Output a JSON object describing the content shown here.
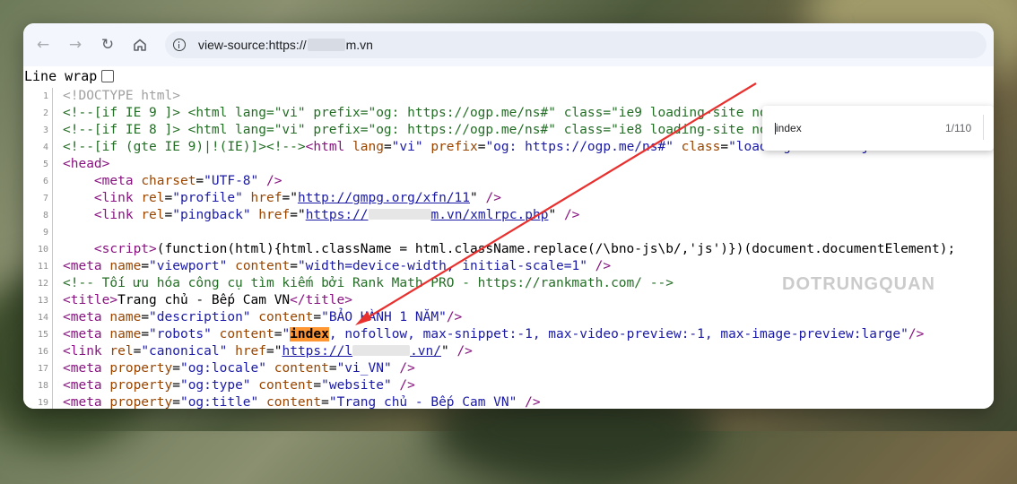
{
  "browser": {
    "url_prefix": "view-source:https://",
    "url_suffix": "m.vn"
  },
  "line_wrap_label": "Line wrap",
  "find": {
    "query": "index",
    "count": "1/110"
  },
  "watermark": "DOTRUNGQUAN",
  "lines": [
    {
      "n": "1",
      "s": [
        [
          "d",
          "<!DOCTYPE html>"
        ]
      ]
    },
    {
      "n": "2",
      "s": [
        [
          "c",
          "<!--[if IE 9 ]> <html lang=\"vi\" prefix=\"og: https://ogp.me/ns#\" class=\"ie9 loading-site no-js\"> <![endif]-->"
        ]
      ]
    },
    {
      "n": "3",
      "s": [
        [
          "c",
          "<!--[if IE 8 ]> <html lang=\"vi\" prefix=\"og: https://ogp.me/ns#\" class=\"ie8 loading-site no-js\"> <![endif]-->"
        ]
      ]
    },
    {
      "n": "4",
      "s": [
        [
          "c",
          "<!--[if (gte IE 9)|!(IE)]><!-->"
        ],
        [
          "t",
          "<html "
        ],
        [
          "a",
          "lang"
        ],
        [
          "p",
          "="
        ],
        [
          "v",
          "\"vi\""
        ],
        [
          "a",
          " prefix"
        ],
        [
          "p",
          "="
        ],
        [
          "v",
          "\"og: https://ogp.me/ns#\""
        ],
        [
          "a",
          " class"
        ],
        [
          "p",
          "="
        ],
        [
          "v",
          "\"loading-site no-js\""
        ],
        [
          "t",
          ">"
        ]
      ]
    },
    {
      "n": "5",
      "s": [
        [
          "t",
          "<head>"
        ]
      ]
    },
    {
      "n": "6",
      "s": [
        [
          "p",
          "    "
        ],
        [
          "t",
          "<meta "
        ],
        [
          "a",
          "charset"
        ],
        [
          "p",
          "="
        ],
        [
          "v",
          "\"UTF-8\""
        ],
        [
          "t",
          " />"
        ]
      ]
    },
    {
      "n": "7",
      "s": [
        [
          "p",
          "    "
        ],
        [
          "t",
          "<link "
        ],
        [
          "a",
          "rel"
        ],
        [
          "p",
          "="
        ],
        [
          "v",
          "\"profile\""
        ],
        [
          "a",
          " href"
        ],
        [
          "p",
          "=\""
        ],
        [
          "lk",
          "http://gmpg.org/xfn/11"
        ],
        [
          "p",
          "\""
        ],
        [
          "t",
          " />"
        ]
      ]
    },
    {
      "n": "8",
      "s": [
        [
          "p",
          "    "
        ],
        [
          "t",
          "<link "
        ],
        [
          "a",
          "rel"
        ],
        [
          "p",
          "="
        ],
        [
          "v",
          "\"pingback\""
        ],
        [
          "a",
          " href"
        ],
        [
          "p",
          "=\""
        ],
        [
          "lk",
          "https://"
        ],
        [
          "blur",
          "70"
        ],
        [
          "lk",
          "m.vn/xmlrpc.php"
        ],
        [
          "p",
          "\""
        ],
        [
          "t",
          " />"
        ]
      ]
    },
    {
      "n": "9",
      "s": []
    },
    {
      "n": "10",
      "s": [
        [
          "p",
          "    "
        ],
        [
          "t",
          "<script>"
        ],
        [
          "p",
          "(function(html){html.className = html.className.replace(/\\bno-js\\b/,'js')})(document.documentElement);"
        ]
      ]
    },
    {
      "n": "11",
      "s": [
        [
          "t",
          "<meta "
        ],
        [
          "a",
          "name"
        ],
        [
          "p",
          "="
        ],
        [
          "v",
          "\"viewport\""
        ],
        [
          "a",
          " content"
        ],
        [
          "p",
          "="
        ],
        [
          "v",
          "\"width=device-width, initial-scale=1\""
        ],
        [
          "t",
          " />"
        ]
      ]
    },
    {
      "n": "12",
      "s": [
        [
          "c",
          "<!-- Tối ưu hóa công cụ tìm kiếm bởi Rank Math PRO - https://rankmath.com/ -->"
        ]
      ]
    },
    {
      "n": "13",
      "s": [
        [
          "t",
          "<title>"
        ],
        [
          "p",
          "Trang chủ - Bếp Cam VN"
        ],
        [
          "t",
          "</title>"
        ]
      ]
    },
    {
      "n": "14",
      "s": [
        [
          "t",
          "<meta "
        ],
        [
          "a",
          "name"
        ],
        [
          "p",
          "="
        ],
        [
          "v",
          "\"description\""
        ],
        [
          "a",
          " content"
        ],
        [
          "p",
          "="
        ],
        [
          "v",
          "\"BẢO HÀNH 1 NĂM\""
        ],
        [
          "t",
          "/>"
        ]
      ]
    },
    {
      "n": "15",
      "s": [
        [
          "t",
          "<meta "
        ],
        [
          "a",
          "name"
        ],
        [
          "p",
          "="
        ],
        [
          "v",
          "\"robots\""
        ],
        [
          "a",
          " content"
        ],
        [
          "p",
          "="
        ],
        [
          "v",
          "\""
        ],
        [
          "hl",
          "index"
        ],
        [
          "v",
          ", nofollow, max-snippet:-1, max-video-preview:-1, max-image-preview:large\""
        ],
        [
          "t",
          "/>"
        ]
      ]
    },
    {
      "n": "16",
      "s": [
        [
          "t",
          "<link "
        ],
        [
          "a",
          "rel"
        ],
        [
          "p",
          "="
        ],
        [
          "v",
          "\"canonical\""
        ],
        [
          "a",
          " href"
        ],
        [
          "p",
          "=\""
        ],
        [
          "lk",
          "https://l"
        ],
        [
          "blur",
          "64"
        ],
        [
          "lk",
          ".vn/"
        ],
        [
          "p",
          "\""
        ],
        [
          "t",
          " />"
        ]
      ]
    },
    {
      "n": "17",
      "s": [
        [
          "t",
          "<meta "
        ],
        [
          "a",
          "property"
        ],
        [
          "p",
          "="
        ],
        [
          "v",
          "\"og:locale\""
        ],
        [
          "a",
          " content"
        ],
        [
          "p",
          "="
        ],
        [
          "v",
          "\"vi_VN\""
        ],
        [
          "t",
          " />"
        ]
      ]
    },
    {
      "n": "18",
      "s": [
        [
          "t",
          "<meta "
        ],
        [
          "a",
          "property"
        ],
        [
          "p",
          "="
        ],
        [
          "v",
          "\"og:type\""
        ],
        [
          "a",
          " content"
        ],
        [
          "p",
          "="
        ],
        [
          "v",
          "\"website\""
        ],
        [
          "t",
          " />"
        ]
      ]
    },
    {
      "n": "19",
      "s": [
        [
          "t",
          "<meta "
        ],
        [
          "a",
          "property"
        ],
        [
          "p",
          "="
        ],
        [
          "v",
          "\"og:title\""
        ],
        [
          "a",
          " content"
        ],
        [
          "p",
          "="
        ],
        [
          "v",
          "\"Trang chủ - Bếp Cam VN\""
        ],
        [
          "t",
          " />"
        ]
      ]
    }
  ]
}
